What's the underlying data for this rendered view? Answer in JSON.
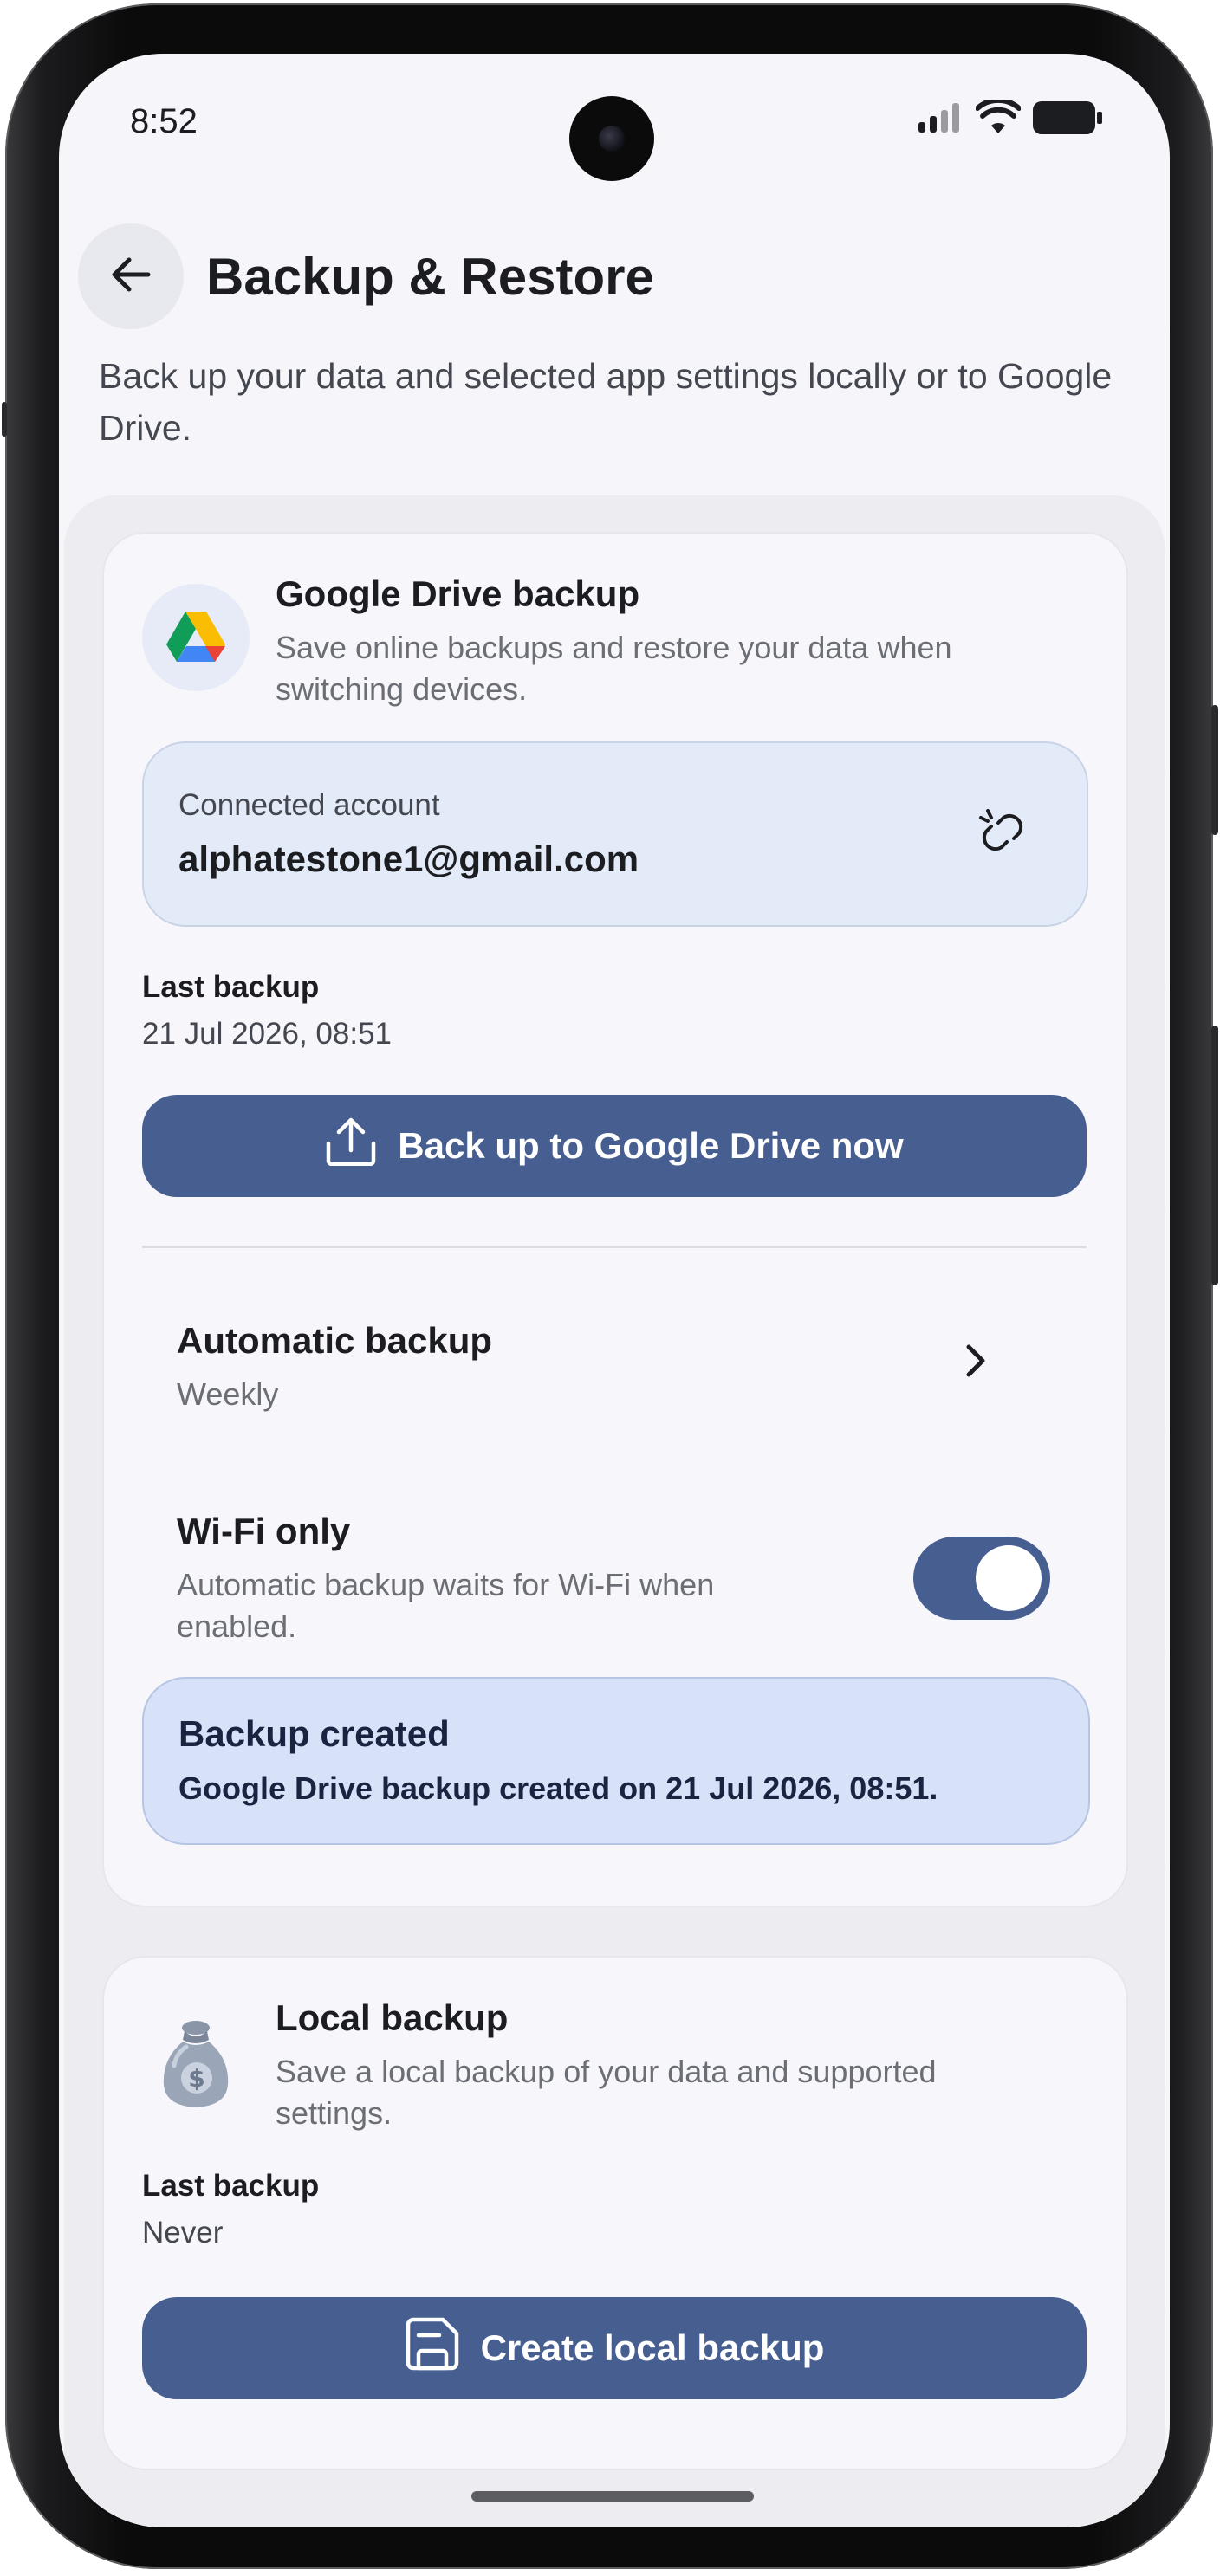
{
  "status_bar": {
    "time": "8:52",
    "icons": [
      "signal-icon",
      "wifi-icon",
      "battery-icon"
    ]
  },
  "header": {
    "back_icon": "arrow-left-icon",
    "title": "Backup & Restore"
  },
  "subtitle": "Back up your data and selected app settings locally or to Google Drive.",
  "drive_card": {
    "icon": "google-drive-icon",
    "title": "Google Drive backup",
    "description": "Save online backups and restore your data when switching devices.",
    "account": {
      "label": "Connected account",
      "email": "alphatestone1@gmail.com",
      "action_icon": "unlink-icon"
    },
    "last_backup_label": "Last backup",
    "last_backup_value": "21 Jul 2026, 08:51",
    "backup_button": {
      "label": "Back up to Google Drive now",
      "icon": "upload-icon"
    },
    "automatic_backup": {
      "title": "Automatic backup",
      "value": "Weekly",
      "icon": "chevron-right-icon"
    },
    "wifi_only": {
      "title": "Wi-Fi only",
      "description": "Automatic backup waits for Wi-Fi when enabled.",
      "enabled": true
    },
    "notice": {
      "title": "Backup created",
      "body": "Google Drive backup created on 21 Jul 2026, 08:51."
    }
  },
  "local_card": {
    "icon": "money-bag-icon",
    "title": "Local backup",
    "description": "Save a local backup of your data and supported settings.",
    "last_backup_label": "Last backup",
    "last_backup_value": "Never",
    "create_button": {
      "label": "Create local backup",
      "icon": "save-icon"
    }
  },
  "colors": {
    "primary": "#465e90",
    "background": "#f6f5fa",
    "account_box": "#e4ebf8",
    "notice": "#d7e2f8"
  }
}
